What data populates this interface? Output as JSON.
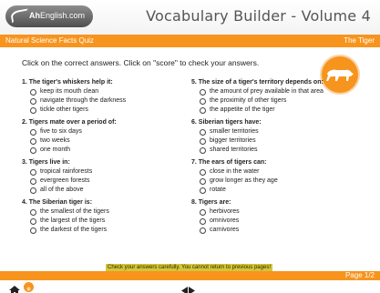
{
  "header": {
    "logo_text_bold": "Ah",
    "logo_text_rest": "English.com",
    "app_title": "Vocabulary Builder - Volume 4"
  },
  "subbar": {
    "quiz_name": "Natural Science Facts Quiz",
    "topic": "The Tiger"
  },
  "instructions": "Click on the correct answers.  Click on \"score\" to check your answers.",
  "questions_left": [
    {
      "text": "1. The tiger's whiskers help it:",
      "options": [
        "keep its mouth clean",
        "navigate through the darkness",
        "tickle other tigers"
      ]
    },
    {
      "text": "2. Tigers mate over a period of:",
      "options": [
        "five to six days",
        "two weeks",
        "one month"
      ]
    },
    {
      "text": "3. Tigers live in:",
      "options": [
        "tropical rainforests",
        "evergreen forests",
        "all of the above"
      ]
    },
    {
      "text": "4. The Siberian tiger is:",
      "options": [
        "the smallest of the tigers",
        "the largest of the tigers",
        "the darkest of the tigers"
      ]
    }
  ],
  "questions_right": [
    {
      "text": "5. The size of a tiger's territory depends on:",
      "options": [
        "the amount of prey available in that area",
        "the proximity of other tigers",
        "the appetite of the tiger"
      ]
    },
    {
      "text": "6. Siberian tigers have:",
      "options": [
        "smaller territories",
        "bigger territories",
        "shared territories"
      ]
    },
    {
      "text": "7. The ears of tigers can:",
      "options": [
        "close in the water",
        "grow longer as they age",
        "rotate"
      ]
    },
    {
      "text": "8. Tigers are:",
      "options": [
        "herbivores",
        "omnivores",
        "carnivores"
      ]
    }
  ],
  "warning": "Check your answers carefully.  You cannot return to previous pages!",
  "footer": {
    "page_indicator": "Page 1/2"
  },
  "colors": {
    "accent": "#f7941d",
    "warning_bg": "#d4c63a"
  },
  "icons": {
    "home": "home-icon",
    "score": "score-icon",
    "prev": "arrow-left-icon",
    "next": "arrow-right-icon",
    "badge": "tiger-icon"
  }
}
